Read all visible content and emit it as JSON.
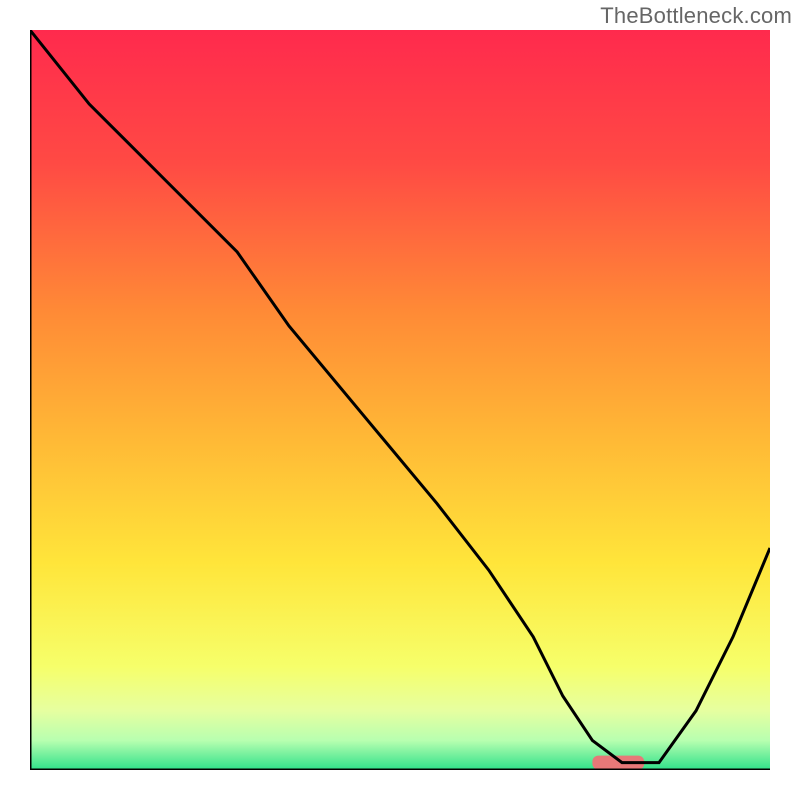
{
  "watermark": "TheBottleneck.com",
  "chart_data": {
    "type": "line",
    "title": "",
    "xlabel": "",
    "ylabel": "",
    "xlim": [
      0,
      100
    ],
    "ylim": [
      0,
      100
    ],
    "series": [
      {
        "name": "bottleneck-curve",
        "x": [
          0,
          8,
          18,
          28,
          35,
          45,
          55,
          62,
          68,
          72,
          76,
          80,
          85,
          90,
          95,
          100
        ],
        "y": [
          100,
          90,
          80,
          70,
          60,
          48,
          36,
          27,
          18,
          10,
          4,
          1,
          1,
          8,
          18,
          30
        ]
      }
    ],
    "marker": {
      "name": "optimal-range",
      "x_start": 76,
      "x_end": 83,
      "y": 1,
      "color": "#e77878"
    },
    "background_gradient": {
      "stops": [
        {
          "offset": 0.0,
          "color": "#ff2a4d"
        },
        {
          "offset": 0.18,
          "color": "#ff4a44"
        },
        {
          "offset": 0.38,
          "color": "#ff8a36"
        },
        {
          "offset": 0.55,
          "color": "#ffb836"
        },
        {
          "offset": 0.72,
          "color": "#ffe53a"
        },
        {
          "offset": 0.86,
          "color": "#f6ff6a"
        },
        {
          "offset": 0.92,
          "color": "#e6ffa0"
        },
        {
          "offset": 0.96,
          "color": "#b8ffb0"
        },
        {
          "offset": 1.0,
          "color": "#2fe08a"
        }
      ]
    }
  }
}
